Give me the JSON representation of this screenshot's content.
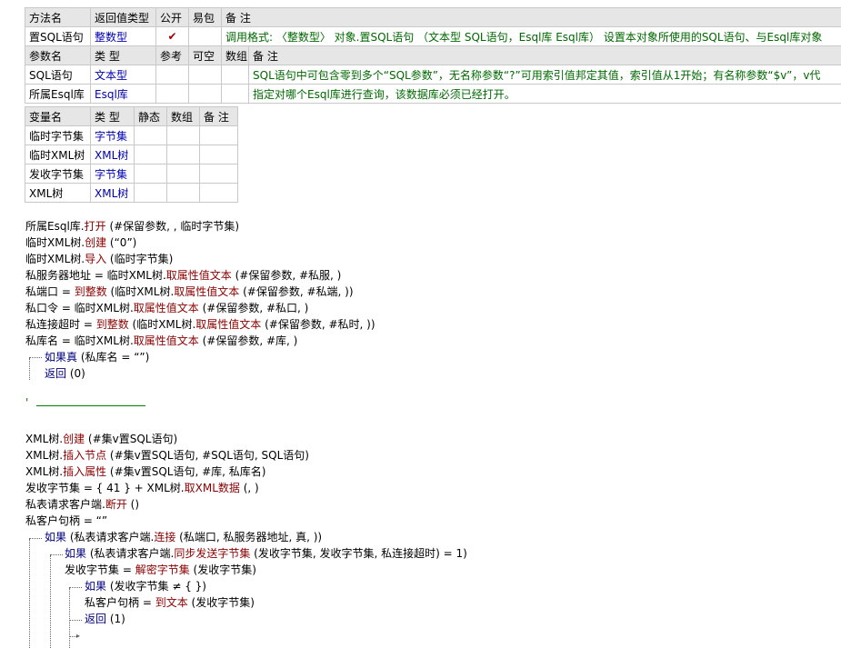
{
  "method_table": {
    "headers": [
      "方法名",
      "返回值类型",
      "公开",
      "易包",
      "备 注"
    ],
    "row": {
      "name": "置SQL语句",
      "return_type": "整数型",
      "public_check": "✔",
      "note": "调用格式: 〈整数型〉 对象.置SQL语句 （文本型 SQL语句，Esql库 Esql库）    设置本对象所使用的SQL语句、与Esql库对象"
    }
  },
  "param_table": {
    "headers": [
      "参数名",
      "类 型",
      "参考",
      "可空",
      "数组",
      "备 注"
    ],
    "rows": [
      {
        "name": "SQL语句",
        "type": "文本型",
        "note": "SQL语句中可包含零到多个“SQL参数”，无名称参数“?”可用索引值邦定其值，索引值从1开始；有名称参数“$v”，v代"
      },
      {
        "name": "所属Esql库",
        "type": "Esql库",
        "note": "指定对哪个Esql库进行查询，该数据库必须已经打开。"
      }
    ]
  },
  "var_table": {
    "headers": [
      "变量名",
      "类 型",
      "静态",
      "数组",
      "备 注"
    ],
    "rows": [
      {
        "name": "临时字节集",
        "type": "字节集"
      },
      {
        "name": "临时XML树",
        "type": "XML树"
      },
      {
        "name": "发收字节集",
        "type": "字节集"
      },
      {
        "name": "XML树",
        "type": "XML树"
      }
    ]
  },
  "code": {
    "l1a": "所属Esql库.",
    "l1b": "打开",
    "l1c": " (#保留参数, , 临时字节集)",
    "l2a": "临时XML树.",
    "l2b": "创建",
    "l2c": " (“0”)",
    "l3a": "临时XML树.",
    "l3b": "导入",
    "l3c": " (临时字节集)",
    "l4a": "私服务器地址 = 临时XML树.",
    "l4b": "取属性值文本",
    "l4c": " (#保留参数, #私服, )",
    "l5a": "私端口 = ",
    "l5b": "到整数",
    "l5c": " (临时XML树.",
    "l5d": "取属性值文本",
    "l5e": " (#保留参数, #私端, ))",
    "l6a": "私口令 = 临时XML树.",
    "l6b": "取属性值文本",
    "l6c": " (#保留参数, #私口, )",
    "l7a": "私连接超时 = ",
    "l7b": "到整数",
    "l7c": " (临时XML树.",
    "l7d": "取属性值文本",
    "l7e": " (#保留参数, #私时, ))",
    "l8a": "私库名 = 临时XML树.",
    "l8b": "取属性值文本",
    "l8c": " (#保留参数, #库, )",
    "l9a": "如果真",
    "l9b": " (私库名 = “”)",
    "l10a": "返回",
    "l10b": " (0)",
    "l11": "'",
    "l12a": "XML树.",
    "l12b": "创建",
    "l12c": " (#集v置SQL语句)",
    "l13a": "XML树.",
    "l13b": "插入节点",
    "l13c": " (#集v置SQL语句, #SQL语句, SQL语句)",
    "l14a": "XML树.",
    "l14b": "插入属性",
    "l14c": " (#集v置SQL语句, #库, 私库名)",
    "l15a": "发收字节集 = { 41 } + XML树.",
    "l15b": "取XML数据",
    "l15c": " (, )",
    "l16a": "私表请求客户端.",
    "l16b": "断开",
    "l16c": " ()",
    "l17": "私客户句柄 = “”",
    "l18a": "如果",
    "l18b": " (私表请求客户端.",
    "l18c": "连接",
    "l18d": " (私端口, 私服务器地址, 真, ))",
    "l19a": "如果",
    "l19b": " (私表请求客户端.",
    "l19c": "同步发送字节集",
    "l19d": " (发收字节集, 发收字节集, 私连接超时) = 1)",
    "l20a": "发收字节集 = ",
    "l20b": "解密字节集",
    "l20c": " (发收字节集)",
    "l21a": "如果",
    "l21b": " (发收字节集 ≠ { })",
    "l22a": "私客户句柄 = ",
    "l22b": "到文本",
    "l22c": " (发收字节集)",
    "l23a": "返回",
    "l23b": " (1)"
  }
}
